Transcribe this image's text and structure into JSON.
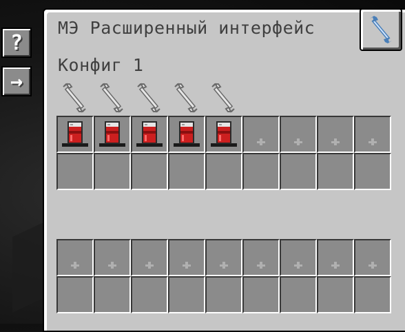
{
  "title": "МЭ Расширенный интерфейс",
  "config_label": "Конфиг 1",
  "side_buttons": [
    {
      "name": "help",
      "label": "?"
    },
    {
      "name": "arrow",
      "label": "→"
    }
  ],
  "icons": {
    "tab": "wrench-icon",
    "upgrade_slot": "wrench-outline-icon",
    "config_slot": "arrow-down-icon",
    "item": "fluid-storage-cell-icon"
  },
  "upgrade_slot_count": 5,
  "config_rows": [
    [
      "cell",
      "cell",
      "cell",
      "cell",
      "cell",
      "empty",
      "empty",
      "empty",
      "empty"
    ],
    [
      "empty",
      "empty",
      "empty",
      "empty",
      "empty",
      "empty",
      "empty",
      "empty",
      "empty"
    ]
  ],
  "colors": {
    "panel": "#c6c6c6",
    "slot": "#8b8b8b",
    "text": "#404040",
    "cell_red": "#cc1f1f"
  }
}
